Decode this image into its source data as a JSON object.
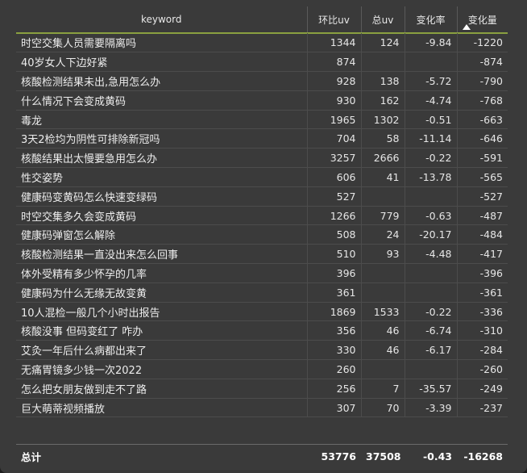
{
  "table": {
    "columns": [
      {
        "label": "keyword"
      },
      {
        "label": "环比uv"
      },
      {
        "label": "总uv"
      },
      {
        "label": "变化率"
      },
      {
        "label": "变化量"
      }
    ],
    "sorted_column": "变化量",
    "sort_direction": "ascending",
    "rows": [
      {
        "keyword": "时空交集人员需要隔离吗",
        "uv_prev": "1344",
        "uv_total": "124",
        "rate": "-9.84",
        "delta": "-1220"
      },
      {
        "keyword": "40岁女人下边好紧",
        "uv_prev": "874",
        "uv_total": "",
        "rate": "",
        "delta": "-874"
      },
      {
        "keyword": "核酸检测结果未出,急用怎么办",
        "uv_prev": "928",
        "uv_total": "138",
        "rate": "-5.72",
        "delta": "-790"
      },
      {
        "keyword": "什么情况下会变成黄码",
        "uv_prev": "930",
        "uv_total": "162",
        "rate": "-4.74",
        "delta": "-768"
      },
      {
        "keyword": "毒龙",
        "uv_prev": "1965",
        "uv_total": "1302",
        "rate": "-0.51",
        "delta": "-663"
      },
      {
        "keyword": "3天2检均为阴性可排除新冠吗",
        "uv_prev": "704",
        "uv_total": "58",
        "rate": "-11.14",
        "delta": "-646"
      },
      {
        "keyword": "核酸结果出太慢要急用怎么办",
        "uv_prev": "3257",
        "uv_total": "2666",
        "rate": "-0.22",
        "delta": "-591"
      },
      {
        "keyword": "性交姿势",
        "uv_prev": "606",
        "uv_total": "41",
        "rate": "-13.78",
        "delta": "-565"
      },
      {
        "keyword": "健康码变黄码怎么快速变绿码",
        "uv_prev": "527",
        "uv_total": "",
        "rate": "",
        "delta": "-527"
      },
      {
        "keyword": "时空交集多久会变成黄码",
        "uv_prev": "1266",
        "uv_total": "779",
        "rate": "-0.63",
        "delta": "-487"
      },
      {
        "keyword": "健康码弹窗怎么解除",
        "uv_prev": "508",
        "uv_total": "24",
        "rate": "-20.17",
        "delta": "-484"
      },
      {
        "keyword": "核酸检测结果一直没出来怎么回事",
        "uv_prev": "510",
        "uv_total": "93",
        "rate": "-4.48",
        "delta": "-417"
      },
      {
        "keyword": "体外受精有多少怀孕的几率",
        "uv_prev": "396",
        "uv_total": "",
        "rate": "",
        "delta": "-396"
      },
      {
        "keyword": "健康码为什么无缘无故变黄",
        "uv_prev": "361",
        "uv_total": "",
        "rate": "",
        "delta": "-361"
      },
      {
        "keyword": "10人混检一般几个小时出报告",
        "uv_prev": "1869",
        "uv_total": "1533",
        "rate": "-0.22",
        "delta": "-336"
      },
      {
        "keyword": "核酸没事 但码变红了 咋办",
        "uv_prev": "356",
        "uv_total": "46",
        "rate": "-6.74",
        "delta": "-310"
      },
      {
        "keyword": "艾灸一年后什么病都出来了",
        "uv_prev": "330",
        "uv_total": "46",
        "rate": "-6.17",
        "delta": "-284"
      },
      {
        "keyword": "无痛胃镜多少钱一次2022",
        "uv_prev": "260",
        "uv_total": "",
        "rate": "",
        "delta": "-260"
      },
      {
        "keyword": "怎么把女朋友做到走不了路",
        "uv_prev": "256",
        "uv_total": "7",
        "rate": "-35.57",
        "delta": "-249"
      },
      {
        "keyword": "巨大萌蒂视频播放",
        "uv_prev": "307",
        "uv_total": "70",
        "rate": "-3.39",
        "delta": "-237"
      }
    ],
    "footer": {
      "label": "总计",
      "uv_prev": "53776",
      "uv_total": "37508",
      "rate": "-0.43",
      "delta": "-16268"
    }
  }
}
